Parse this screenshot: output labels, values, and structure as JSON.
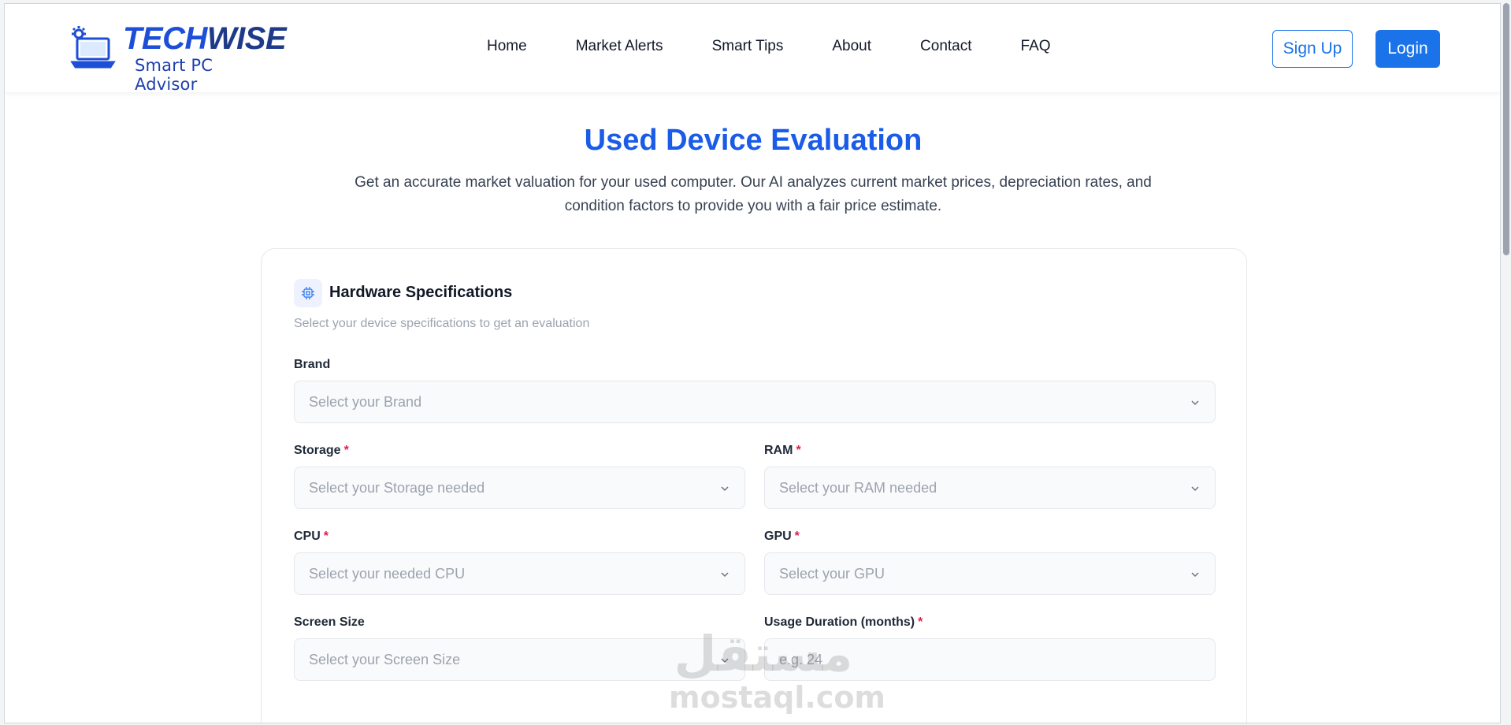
{
  "brand": {
    "name_part1": "TECH",
    "name_part2": "WISE",
    "tagline": "Smart PC Advisor"
  },
  "nav": {
    "items": [
      {
        "label": "Home"
      },
      {
        "label": "Market Alerts"
      },
      {
        "label": "Smart Tips"
      },
      {
        "label": "About"
      },
      {
        "label": "Contact"
      },
      {
        "label": "FAQ"
      }
    ]
  },
  "auth": {
    "signup_label": "Sign Up",
    "login_label": "Login"
  },
  "hero": {
    "title": "Used Device Evaluation",
    "description": "Get an accurate market valuation for your used computer. Our AI analyzes current market prices, depreciation rates, and condition factors to provide you with a fair price estimate."
  },
  "card": {
    "title": "Hardware Specifications",
    "subtitle": "Select your device specifications to get an evaluation",
    "icon": "cpu-chip-icon"
  },
  "form": {
    "brand": {
      "label": "Brand",
      "required": false,
      "placeholder": "Select your Brand"
    },
    "storage": {
      "label": "Storage",
      "required": true,
      "placeholder": "Select your Storage needed"
    },
    "ram": {
      "label": "RAM",
      "required": true,
      "placeholder": "Select your RAM needed"
    },
    "cpu": {
      "label": "CPU",
      "required": true,
      "placeholder": "Select your needed CPU"
    },
    "gpu": {
      "label": "GPU",
      "required": true,
      "placeholder": "Select your GPU"
    },
    "screen_size": {
      "label": "Screen Size",
      "required": false,
      "placeholder": "Select your Screen Size"
    },
    "usage_duration": {
      "label": "Usage Duration (months)",
      "required": true,
      "placeholder": "e.g. 24"
    },
    "required_mark": "*"
  },
  "watermark": {
    "arabic": "مستقل",
    "latin": "mostaql.com"
  },
  "colors": {
    "primary": "#1a73e8",
    "title": "#1a5be8",
    "required": "#e11d48"
  }
}
